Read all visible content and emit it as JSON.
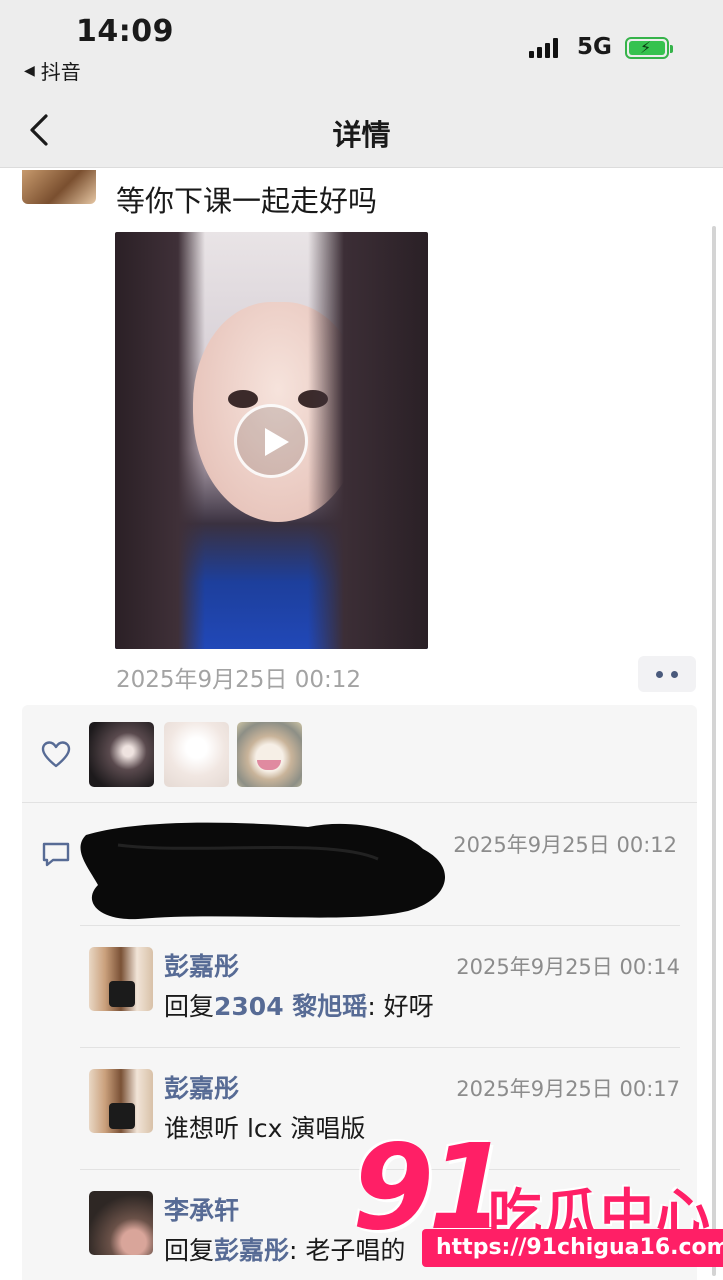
{
  "status_bar": {
    "time": "14:09",
    "back_app_label": "抖音",
    "network": "5G"
  },
  "nav": {
    "title": "详情"
  },
  "post": {
    "text": "等你下课一起走好吗",
    "timestamp": "2025年9月25日 00:12"
  },
  "comments": {
    "first_time": "2025年9月25日 00:12",
    "replies": [
      {
        "name": "彭嘉彤",
        "time": "2025年9月25日 00:14",
        "prefix": "回复",
        "target": "2304 黎旭瑶",
        "text": ": 好呀"
      },
      {
        "name": "彭嘉彤",
        "time": "2025年9月25日 00:17",
        "prefix": "",
        "target": "",
        "text": "谁想听 lcx 演唱版"
      },
      {
        "name": "李承轩",
        "time": "",
        "prefix": "回复",
        "target": "彭嘉彤",
        "text": ": 老子唱的"
      }
    ]
  },
  "watermark": {
    "number": "91",
    "chinese": "吃瓜中心",
    "url": "https://91chigua16.com"
  },
  "colors": {
    "link_name": "#576b95",
    "watermark": "#ff1f66",
    "battery": "#36c24f"
  }
}
